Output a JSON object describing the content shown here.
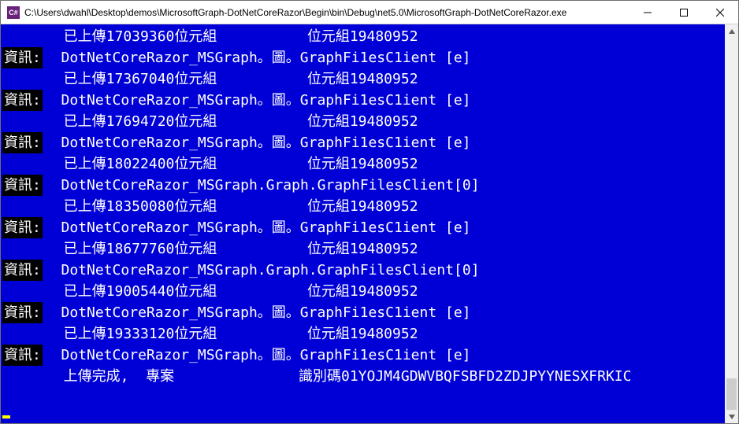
{
  "window": {
    "title": "C:\\Users\\dwahl\\Desktop\\demos\\MicrosoftGraph-DotNetCoreRazor\\Begin\\bin\\Debug\\net5.0\\MicrosoftGraph-DotNetCoreRazor.exe",
    "icon_label": "C#"
  },
  "level_label": "資訊:",
  "total_bytes": "19480952",
  "upload_prefix": "已上傳",
  "upload_mid": "位元組",
  "upload_right_label": "位元組",
  "client_line_cjk": "DotNetCoreRazor_MSGraph。圖。GraphFi1esC1ient [e]",
  "client_line_ascii": "DotNetCoreRazor_MSGraph.Graph.GraphFilesClient[0]",
  "rows": [
    {
      "t": "upload",
      "bytes": "17039360"
    },
    {
      "t": "client_cjk"
    },
    {
      "t": "upload",
      "bytes": "17367040"
    },
    {
      "t": "client_cjk"
    },
    {
      "t": "upload",
      "bytes": "17694720"
    },
    {
      "t": "client_cjk"
    },
    {
      "t": "upload",
      "bytes": "18022400"
    },
    {
      "t": "client_ascii"
    },
    {
      "t": "upload",
      "bytes": "18350080"
    },
    {
      "t": "client_cjk"
    },
    {
      "t": "upload",
      "bytes": "18677760"
    },
    {
      "t": "client_ascii"
    },
    {
      "t": "upload",
      "bytes": "19005440"
    },
    {
      "t": "client_cjk"
    },
    {
      "t": "upload",
      "bytes": "19333120"
    },
    {
      "t": "client_cjk"
    }
  ],
  "final": {
    "left": "上傳完成,  專案",
    "mid_label": "識別碼",
    "id": "01YOJM4GDWVBQFSBFD2ZDJPYYNESXFRKIC"
  }
}
